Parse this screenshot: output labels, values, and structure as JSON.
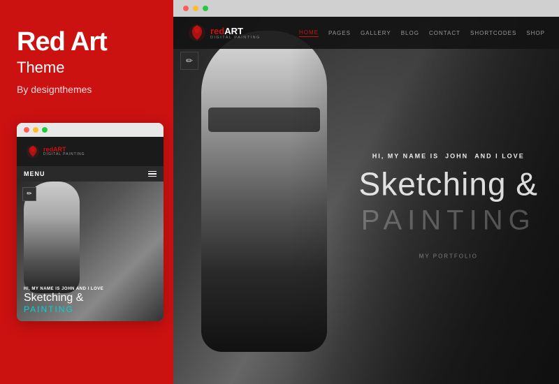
{
  "left": {
    "title": "Red Art",
    "subtitle": "Theme",
    "author": "By designthemes"
  },
  "mobile": {
    "logo_red": "red",
    "logo_art": "ART",
    "logo_sub": "Digital Painting",
    "menu_label": "MENU",
    "hi_text": "HI, MY NAME IS",
    "hi_name": "JOHN",
    "hi_suffix": "AND I LOVE",
    "sketching": "Sketching &",
    "painting": "PAINTING"
  },
  "desktop": {
    "logo_red": "red",
    "logo_art": "ART",
    "logo_sub": "Digital Painting",
    "nav": {
      "home": "HOME",
      "pages": "PAGES",
      "gallery": "GALLERY",
      "blog": "BLOG",
      "contact": "CONTACT",
      "shortcodes": "SHORTCODES",
      "shop": "SHOP"
    },
    "hero": {
      "hi_text": "HI, MY NAME IS",
      "hi_name": "JOHN",
      "hi_suffix": "AND I LOVE",
      "sketching": "Sketching &",
      "painting": "PAINTING",
      "portfolio": "MY PORTFOLIO"
    }
  },
  "dots": {
    "red": "#ff5f56",
    "yellow": "#ffbd2e",
    "green": "#27c93f"
  },
  "pencil_icon": "✏"
}
